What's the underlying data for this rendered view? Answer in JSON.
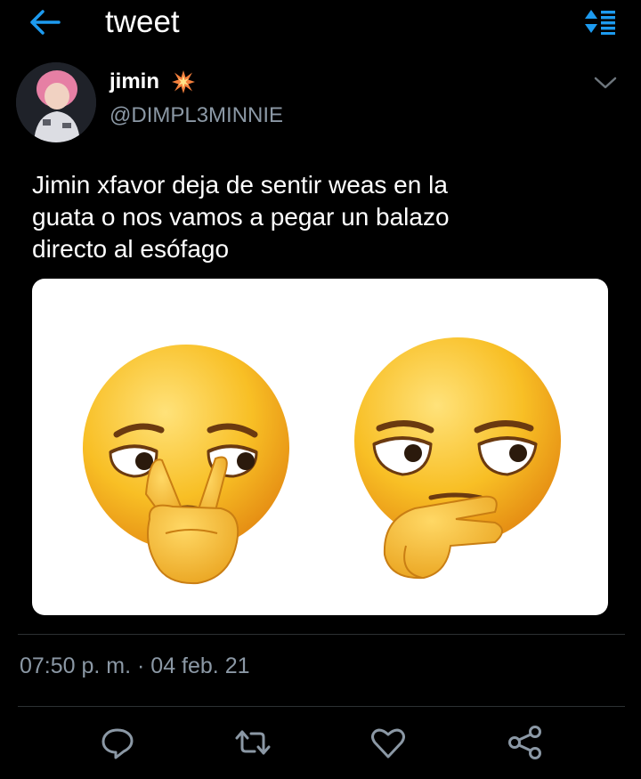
{
  "header": {
    "title": "tweet",
    "back_icon": "arrow-left-icon",
    "sort_icon": "sort-icon",
    "accent": "#1d9bf0"
  },
  "author": {
    "name": "jimin",
    "name_badge_icon": "collision-icon",
    "handle": "@DIMPL3MINNIE",
    "menu_icon": "chevron-down-icon"
  },
  "tweet": {
    "text_lines": [
      "Jimin xfavor deja de sentir weas en la",
      "guata o nos vamos a pegar un balazo",
      "directo al esófago"
    ]
  },
  "meta": {
    "timestamp": "07:50 p. m. · 04 feb. 21"
  },
  "actions": [
    "reply-icon",
    "retweet-icon",
    "like-icon",
    "share-icon"
  ],
  "colors": {
    "background": "#000000",
    "text": "#ffffff",
    "secondary": "#8b98a5",
    "emoji": "#f7c02a"
  }
}
